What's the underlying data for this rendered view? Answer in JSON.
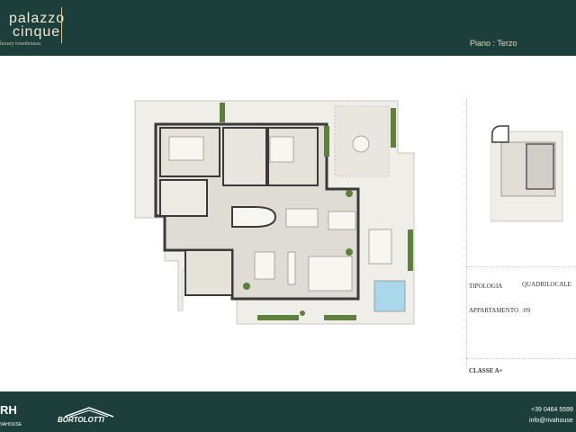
{
  "header": {
    "logo_line1": "palazzo",
    "logo_line2": "cinque",
    "logo_sub": "luxury townhouses",
    "piano": "Piano :  Terzo"
  },
  "details": {
    "tipologia_label": "TIPOLOGIA",
    "tipologia_value": "QUADRILOCALE",
    "appartamento_label": "APPARTAMENTO",
    "appartamento_value": ":09",
    "classe": "CLASSE A+"
  },
  "footer": {
    "rh_logo": "RH",
    "rh_sub": "VAHOUSE",
    "builder": "BORTOLOTTI",
    "phone": "+39 0464 5599",
    "email": "info@rivahouse"
  },
  "colors": {
    "brand_green": "#1c3f3c",
    "brand_gold": "#d9cfa8"
  }
}
